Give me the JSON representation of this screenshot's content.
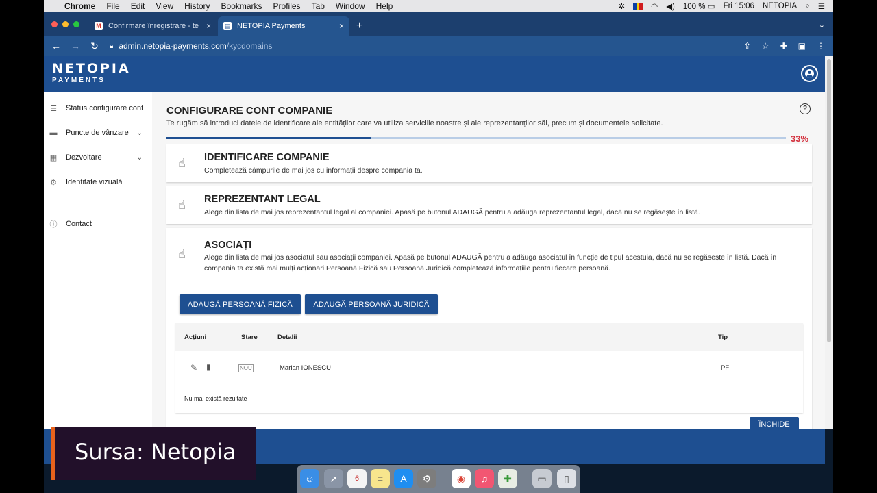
{
  "menubar": {
    "app": "Chrome",
    "items": [
      "File",
      "Edit",
      "View",
      "History",
      "Bookmarks",
      "Profiles",
      "Tab",
      "Window",
      "Help"
    ],
    "battery": "100 %",
    "clock": "Fri 15:06",
    "user": "NETOPIA"
  },
  "tabs": [
    {
      "title": "Confirmare înregistrare - testa"
    },
    {
      "title": "NETOPIA Payments"
    }
  ],
  "address": {
    "host": "admin.netopia-payments.com",
    "path": "/kycdomains"
  },
  "logo": {
    "line1": "NETOPIA",
    "line2": "PAYMENTS"
  },
  "sidebar": {
    "items": [
      {
        "label": "Status configurare cont",
        "icon": "list-icon"
      },
      {
        "label": "Puncte de vânzare",
        "icon": "store-icon",
        "chevron": "⌄"
      },
      {
        "label": "Dezvoltare",
        "icon": "grid-icon",
        "chevron": "⌄"
      },
      {
        "label": "Identitate vizuală",
        "icon": "gear-icon"
      },
      {
        "label": "Contact",
        "icon": "help-icon"
      }
    ]
  },
  "page": {
    "title": "CONFIGURARE CONT COMPANIE",
    "subtitle": "Te rugăm să introduci datele de identificare ale entităților care va utiliza serviciile noastre și ale reprezentanților săi, precum și documentele solicitate.",
    "progress": 0.33,
    "progress_label": "33%"
  },
  "steps": [
    {
      "title": "IDENTIFICARE COMPANIE",
      "desc": "Completează câmpurile de mai jos cu informații despre compania ta."
    },
    {
      "title": "REPREZENTANT LEGAL",
      "desc": "Alege din lista de mai jos reprezentantul legal al companiei. Apasă pe butonul ADAUGĂ pentru a adăuga reprezentantul legal, dacă nu se regăsește în listă."
    },
    {
      "title": "ASOCIAȚI",
      "desc": "Alege din lista de mai jos asociatul sau asociații companiei. Apasă pe butonul ADAUGĂ pentru a adăuga asociatul în funcție de tipul acestuia, dacă nu se regăsește în listă. Dacă în compania ta există mai mulți acționari Persoană Fizică sau Persoană Juridică completează informațiile pentru fiecare persoană."
    }
  ],
  "buttons": {
    "add_pf": "ADAUGĂ PERSOANĂ FIZICĂ",
    "add_pj": "ADAUGĂ PERSOANĂ JURIDICĂ",
    "close": "ÎNCHIDE"
  },
  "table": {
    "headers": {
      "actions": "Acțiuni",
      "status": "Stare",
      "details": "Detalii",
      "type": "Tip"
    },
    "rows": [
      {
        "status": "NOU",
        "details": "Marian IONESCU",
        "type": "PF"
      }
    ],
    "footer": "Nu mai există rezultate"
  },
  "overlay": {
    "source": "Sursa: Netopia"
  },
  "colors": {
    "brand": "#1e4f91",
    "percent": "#d32f3c",
    "accent": "#e8621c"
  }
}
